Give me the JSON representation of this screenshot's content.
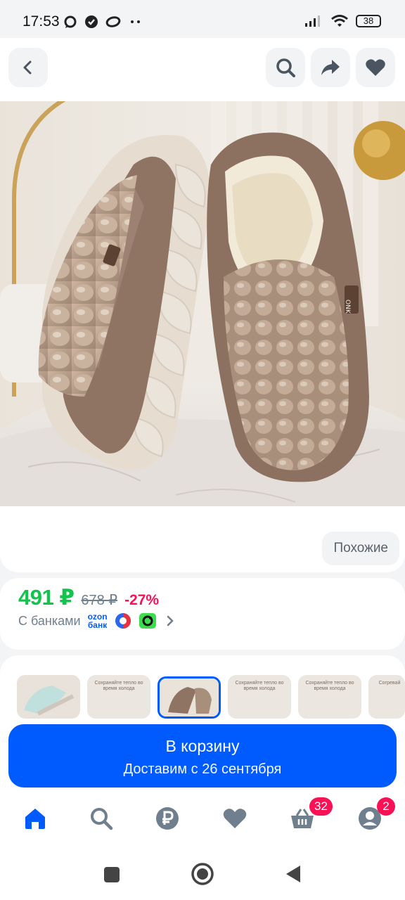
{
  "status_bar": {
    "time": "17:53",
    "battery": "38",
    "icons": [
      "messenger-icon",
      "check-circle-icon",
      "ring-icon",
      "more-dots-icon",
      "signal-icon",
      "wifi-icon",
      "battery-icon"
    ]
  },
  "product": {
    "similar_label": "Похожие",
    "price_current": "491 ₽",
    "price_old": "678 ₽",
    "discount": "-27%",
    "banks_label": "С банками",
    "ozon_bank_logo_line1": "ozon",
    "ozon_bank_logo_line2": "банк"
  },
  "variants": {
    "thumb_texts": [
      "",
      "Сохраняйте тепло во время холода",
      "",
      "Сохраняйте тепло во время холода",
      "Сохраняйте тепло во время холода",
      "Согревай"
    ]
  },
  "cart": {
    "label": "В корзину",
    "delivery": "Доставим с 26 сентября"
  },
  "bottom_nav": {
    "cart_badge": "32",
    "profile_badge": "2"
  },
  "colors": {
    "accent": "#005bff",
    "price_green": "#10c44c",
    "discount_red": "#f91155"
  }
}
